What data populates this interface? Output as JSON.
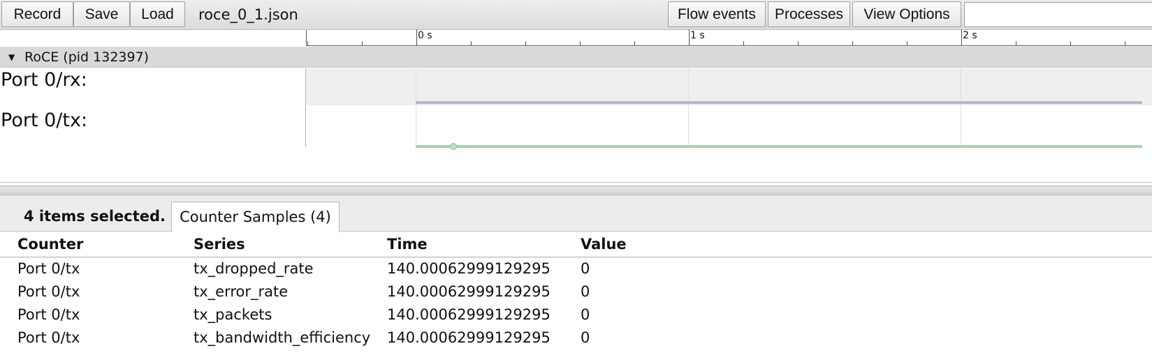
{
  "toolbar": {
    "record_label": "Record",
    "save_label": "Save",
    "load_label": "Load",
    "filename": "roce_0_1.json",
    "flow_events_label": "Flow events",
    "processes_label": "Processes",
    "view_options_label": "View Options",
    "search_value": ""
  },
  "timeline": {
    "ruler": {
      "labels": [
        "0 s",
        "1 s",
        "2 s"
      ]
    },
    "process": {
      "title": "RoCE (pid 132397)",
      "expanded": true
    },
    "tracks": [
      {
        "label": "Port 0/rx:",
        "color": "#b9b3dc"
      },
      {
        "label": "Port 0/tx:",
        "color": "#9ed6a4"
      }
    ]
  },
  "analysis": {
    "selection_count": "4 items selected.",
    "tab_label": "Counter Samples (4)",
    "columns": [
      "Counter",
      "Series",
      "Time",
      "Value"
    ],
    "rows": [
      {
        "counter": "Port 0/tx",
        "series": "tx_dropped_rate",
        "time": "140.00062999129295",
        "value": "0"
      },
      {
        "counter": "Port 0/tx",
        "series": "tx_error_rate",
        "time": "140.00062999129295",
        "value": "0"
      },
      {
        "counter": "Port 0/tx",
        "series": "tx_packets",
        "time": "140.00062999129295",
        "value": "0"
      },
      {
        "counter": "Port 0/tx",
        "series": "tx_bandwidth_efficiency",
        "time": "140.00062999129295",
        "value": "0"
      }
    ]
  },
  "colors": {
    "rx_series": "#b9b3dc",
    "tx_series": "#9ed6a4",
    "selected_band": "#efefef"
  }
}
